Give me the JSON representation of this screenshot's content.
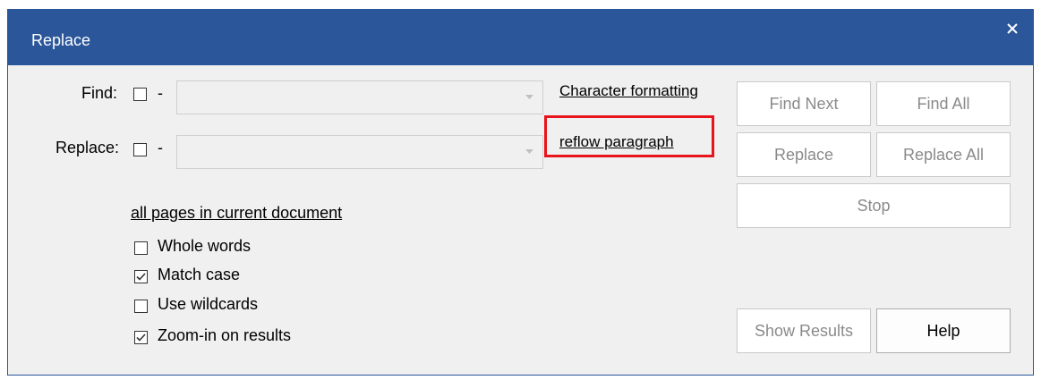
{
  "window": {
    "title": "Replace",
    "close_glyph": "✕"
  },
  "find": {
    "label": "Find:",
    "dash": "-",
    "value": ""
  },
  "replace": {
    "label": "Replace:",
    "dash": "-",
    "value": ""
  },
  "links": {
    "character_formatting": "Character formatting",
    "reflow_paragraph": "reflow paragraph",
    "scope": "all pages in current document"
  },
  "options": [
    {
      "label": "Whole words",
      "checked": false
    },
    {
      "label": "Match case",
      "checked": true
    },
    {
      "label": "Use wildcards",
      "checked": false
    },
    {
      "label": "Zoom-in on results",
      "checked": true
    }
  ],
  "buttons": {
    "find_next": "Find Next",
    "find_all": "Find All",
    "replace": "Replace",
    "replace_all": "Replace All",
    "stop": "Stop",
    "show_results": "Show Results",
    "help": "Help"
  },
  "colors": {
    "titlebar": "#2b579a",
    "highlight": "#e8141b"
  }
}
